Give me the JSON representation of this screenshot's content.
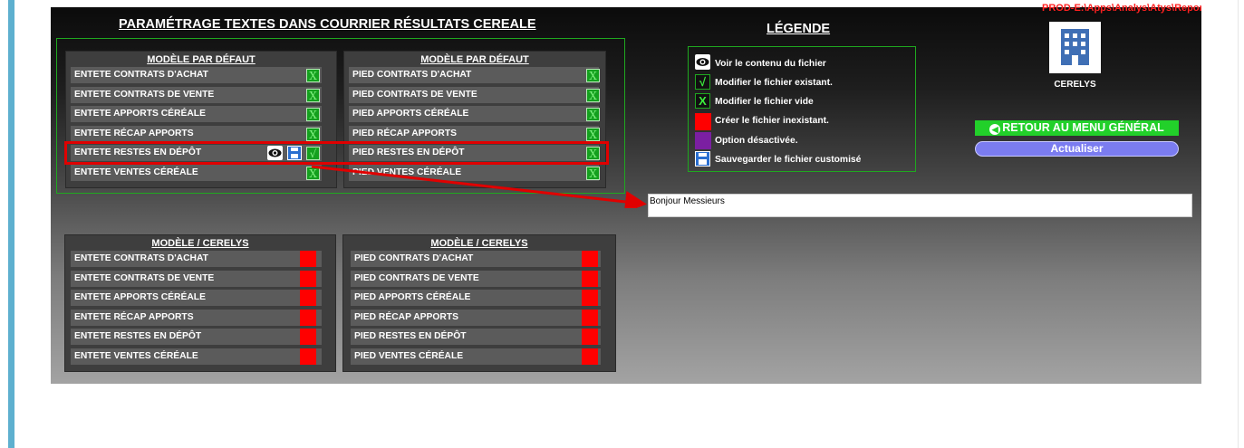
{
  "app": {
    "title": "PARAMÉTRAGE TEXTES DANS COURRIER RÉSULTATS CEREALE",
    "path_label": "PROD-E:\\Apps\\Analys\\Atys\\Repore"
  },
  "colors": {
    "check_green": "#14a01e",
    "missing_red": "#ff0000",
    "disabled_purple": "#7b1fa2",
    "retour_green": "#22d02a",
    "actualiser_blue": "#7b7cf0",
    "highlight_red": "#e00000"
  },
  "panels": {
    "default_header": "MODÈLE PAR DÉFAUT",
    "custom_header": "MODÈLE / CERELYS",
    "default_entete": [
      "ENTETE CONTRATS D'ACHAT",
      "ENTETE CONTRATS DE VENTE",
      "ENTETE APPORTS CÉRÉALE",
      "ENTETE RÉCAP APPORTS",
      "ENTETE RESTES EN DÉPÔT",
      "ENTETE VENTES CÉRÉALE"
    ],
    "default_pied": [
      "PIED CONTRATS D'ACHAT",
      "PIED CONTRATS DE VENTE",
      "PIED APPORTS CÉRÉALE",
      "PIED RÉCAP APPORTS",
      "PIED RESTES EN DÉPÔT",
      "PIED VENTES CÉRÉALE"
    ],
    "custom_entete": [
      "ENTETE CONTRATS D'ACHAT",
      "ENTETE CONTRATS DE VENTE",
      "ENTETE APPORTS CÉRÉALE",
      "ENTETE RÉCAP APPORTS",
      "ENTETE RESTES EN DÉPÔT",
      "ENTETE VENTES CÉRÉALE"
    ],
    "custom_pied": [
      "PIED CONTRATS D'ACHAT",
      "PIED CONTRATS DE VENTE",
      "PIED APPORTS CÉRÉALE",
      "PIED RÉCAP APPORTS",
      "PIED RESTES EN DÉPÔT",
      "PIED VENTES CÉRÉALE"
    ],
    "check_glyph": "X",
    "existing_glyph": "√"
  },
  "legend": {
    "title": "LÉGENDE",
    "items": {
      "view": {
        "label": "Voir le contenu du fichier",
        "icon": "eye-icon"
      },
      "modify_existing": {
        "label": "Modifier le fichier existant.",
        "icon": "check-icon",
        "glyph": "√"
      },
      "modify_empty": {
        "label": "Modifier le fichier vide",
        "icon": "x-icon",
        "glyph": "X"
      },
      "create": {
        "label": "Créer le fichier inexistant.",
        "icon": "red-square-icon"
      },
      "disabled": {
        "label": "Option désactivée.",
        "icon": "purple-square-icon"
      },
      "save": {
        "label": "Sauvegarder le fichier customisé",
        "icon": "floppy-disk-icon"
      }
    }
  },
  "editor": {
    "text": "Bonjour Messieurs"
  },
  "company": {
    "name": "CERELYS",
    "logo_icon": "building-icon"
  },
  "buttons": {
    "retour": "RETOUR AU MENU GÉNÉRAL",
    "retour_icon": "back-arrow-icon",
    "actualiser": "Actualiser"
  }
}
